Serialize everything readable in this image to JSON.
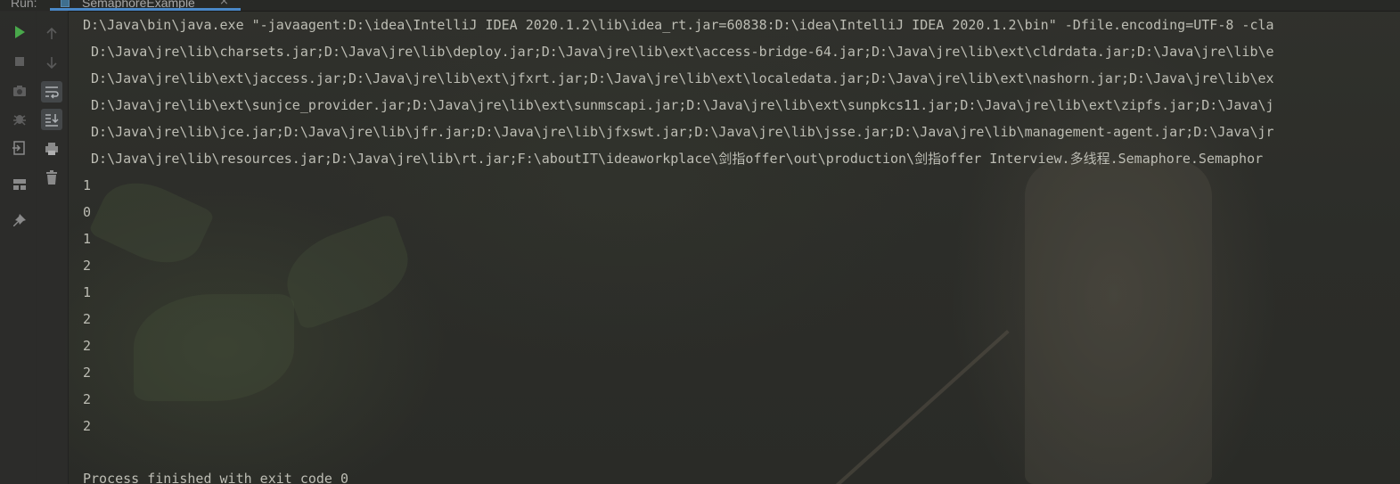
{
  "tab_bar": {
    "run_label": "Run:",
    "tab_title": "SemaphoreExample",
    "close_glyph": "×",
    "accent_color": "#4a88c7"
  },
  "toolbar": {
    "left": [
      {
        "name": "run-icon",
        "color": "#49a84b"
      },
      {
        "name": "stop-icon",
        "color": "#6a6a6a"
      },
      {
        "name": "camera-icon",
        "color": "#6a6a6a"
      },
      {
        "name": "debug-icon",
        "color": "#6a6a6a"
      },
      {
        "name": "exit-icon",
        "color": "#8a8a8a"
      },
      {
        "name": "layout-icon",
        "color": "#8a8a8a"
      },
      {
        "name": "pin-icon",
        "color": "#8a8a8a"
      }
    ],
    "right": [
      {
        "name": "up-arrow-icon"
      },
      {
        "name": "down-arrow-icon"
      },
      {
        "name": "soft-wrap-icon"
      },
      {
        "name": "scroll-to-end-icon"
      },
      {
        "name": "print-icon"
      },
      {
        "name": "trash-icon"
      }
    ]
  },
  "console": {
    "lines": [
      "D:\\Java\\bin\\java.exe \"-javaagent:D:\\idea\\IntelliJ IDEA 2020.1.2\\lib\\idea_rt.jar=60838:D:\\idea\\IntelliJ IDEA 2020.1.2\\bin\" -Dfile.encoding=UTF-8 -cla",
      " D:\\Java\\jre\\lib\\charsets.jar;D:\\Java\\jre\\lib\\deploy.jar;D:\\Java\\jre\\lib\\ext\\access-bridge-64.jar;D:\\Java\\jre\\lib\\ext\\cldrdata.jar;D:\\Java\\jre\\lib\\e",
      " D:\\Java\\jre\\lib\\ext\\jaccess.jar;D:\\Java\\jre\\lib\\ext\\jfxrt.jar;D:\\Java\\jre\\lib\\ext\\localedata.jar;D:\\Java\\jre\\lib\\ext\\nashorn.jar;D:\\Java\\jre\\lib\\ex",
      " D:\\Java\\jre\\lib\\ext\\sunjce_provider.jar;D:\\Java\\jre\\lib\\ext\\sunmscapi.jar;D:\\Java\\jre\\lib\\ext\\sunpkcs11.jar;D:\\Java\\jre\\lib\\ext\\zipfs.jar;D:\\Java\\j",
      " D:\\Java\\jre\\lib\\jce.jar;D:\\Java\\jre\\lib\\jfr.jar;D:\\Java\\jre\\lib\\jfxswt.jar;D:\\Java\\jre\\lib\\jsse.jar;D:\\Java\\jre\\lib\\management-agent.jar;D:\\Java\\jr",
      " D:\\Java\\jre\\lib\\resources.jar;D:\\Java\\jre\\lib\\rt.jar;F:\\aboutIT\\ideaworkplace\\剑指offer\\out\\production\\剑指offer Interview.多线程.Semaphore.Semaphor",
      "1",
      "0",
      "1",
      "2",
      "1",
      "2",
      "2",
      "2",
      "2",
      "2",
      "",
      "Process finished with exit code 0"
    ],
    "text_color": "#bdbdb4"
  }
}
